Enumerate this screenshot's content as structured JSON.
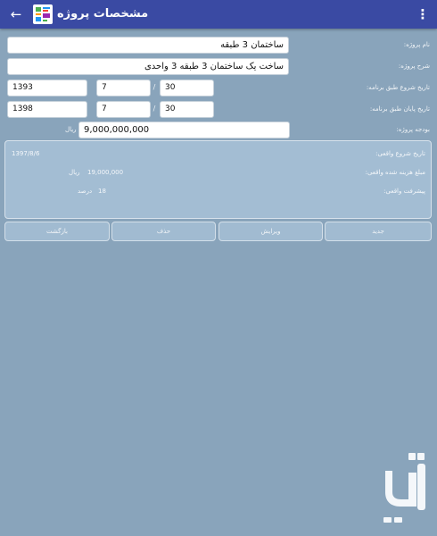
{
  "appbar": {
    "title": "مشخصات پروژه",
    "back_icon": "←",
    "menu_icon": "⋮"
  },
  "form": {
    "project_name_label": "نام پروژه:",
    "project_name_value": "ساختمان 3 طبقه",
    "description_label": "شرح پروژه:",
    "description_value": "ساخت یک ساختمان 3 طبقه 3 واحدی",
    "start_label": "تاریخ شروع طبق برنامه:",
    "start_year": "1393",
    "start_month": "7",
    "start_day": "30",
    "end_label": "تاریخ پایان طبق برنامه:",
    "end_year": "1398",
    "end_month": "7",
    "end_day": "30",
    "separator": "/",
    "budget_label": "بودجه پروژه:",
    "budget_value": "9,000,000,000",
    "budget_unit": "ریال"
  },
  "summary": {
    "actual_start_label": "تاریخ شروع واقعی:",
    "actual_start_value": "1397/8/6",
    "actual_cost_label": "مبلغ هزینه شده واقعی:",
    "actual_cost_value": "19,000,000",
    "actual_cost_unit": "ریال",
    "progress_label": "پیشرفت واقعی:",
    "progress_value": "18",
    "progress_unit": "درصد"
  },
  "buttons": {
    "new": "جدید",
    "edit": "ویرایش",
    "delete": "حذف",
    "back": "بازگشت"
  },
  "colors": {
    "appbar": "#3a4aa3",
    "background": "#89a4bb",
    "panel": "#a3bdd3"
  }
}
